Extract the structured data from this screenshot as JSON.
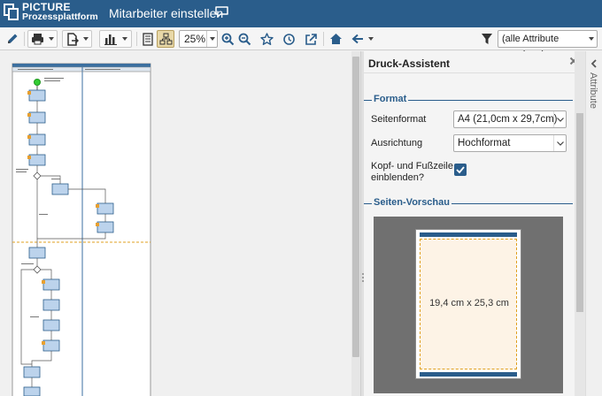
{
  "header": {
    "logo_line1": "PICTURE",
    "logo_line2": "Prozessplattform",
    "title": "Mitarbeiter einstellen",
    "comment_icon": "comment-icon"
  },
  "toolbar": {
    "zoom_value": "25%",
    "attribute_filter_value": "(alle Attribute anzeigen)",
    "icons": [
      "pencil-icon",
      "print-icon",
      "export-icon",
      "chart-icon",
      "page-view-icon",
      "hierarchy-view-icon",
      "zoom-in-icon",
      "zoom-out-icon",
      "star-icon",
      "history-icon",
      "external-link-icon",
      "home-icon",
      "back-arrow-icon",
      "filter-icon"
    ]
  },
  "panel": {
    "title": "Druck-Assistent",
    "format_legend": "Format",
    "page_format_label": "Seitenformat",
    "page_format_value": "A4 (21,0cm x 29,7cm)",
    "orientation_label": "Ausrichtung",
    "orientation_value": "Hochformat",
    "header_footer_label_line1": "Kopf- und Fußzeile",
    "header_footer_label_line2": "einblenden?",
    "header_footer_checked": true,
    "preview_legend": "Seiten-Vorschau",
    "preview_size": "19,4 cm x 25,3 cm"
  },
  "sidetab": {
    "label": "Attribute"
  },
  "colors": {
    "brand": "#2a5d8b",
    "preview_bg": "#707070",
    "page_body": "#fdf3e6",
    "dash": "#e0a020"
  }
}
